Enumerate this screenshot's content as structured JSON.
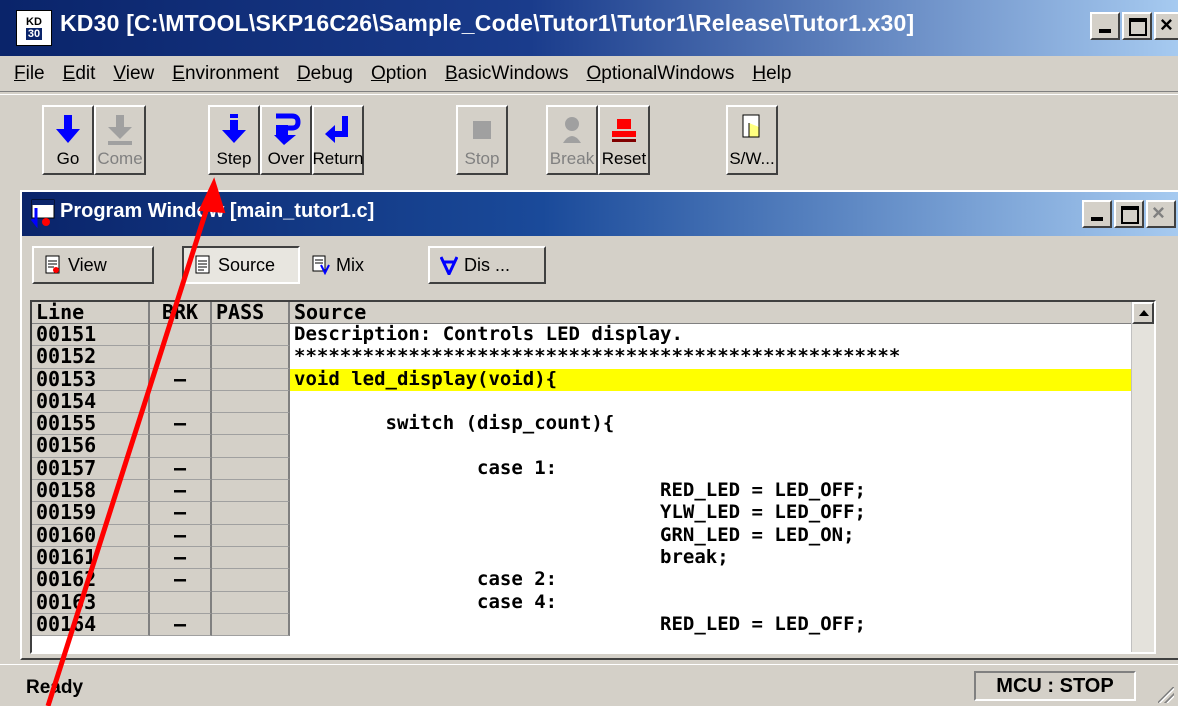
{
  "window": {
    "title": "KD30 [C:\\MTOOL\\SKP16C26\\Sample_Code\\Tutor1\\Tutor1\\Release\\Tutor1.x30]",
    "icon_top": "KD",
    "icon_bottom": "30"
  },
  "menu": [
    "File",
    "Edit",
    "View",
    "Environment",
    "Debug",
    "Option",
    "BasicWindows",
    "OptionalWindows",
    "Help"
  ],
  "toolbar": [
    {
      "label": "Go",
      "icon": "arrow-down-icon",
      "enabled": true
    },
    {
      "label": "Come",
      "icon": "come-icon",
      "enabled": false
    },
    {
      "label": "Step",
      "icon": "step-icon",
      "enabled": true
    },
    {
      "label": "Over",
      "icon": "step-over-icon",
      "enabled": true
    },
    {
      "label": "Return",
      "icon": "return-icon",
      "enabled": true
    },
    {
      "label": "Stop",
      "icon": "stop-icon",
      "enabled": false
    },
    {
      "label": "Break",
      "icon": "break-icon",
      "enabled": false
    },
    {
      "label": "Reset",
      "icon": "reset-icon",
      "enabled": true
    },
    {
      "label": "S/W...",
      "icon": "hand-icon",
      "enabled": true
    }
  ],
  "program_window": {
    "title": "Program Window [main_tutor1.c]",
    "view_buttons": [
      "View",
      "Source",
      "Mix",
      "Dis ..."
    ],
    "columns": [
      "Line",
      "BRK",
      "PASS",
      "Source"
    ],
    "rows": [
      {
        "line": "00151",
        "brk": "",
        "src": "Description: Controls LED display."
      },
      {
        "line": "00152",
        "brk": "",
        "src": "*****************************************************"
      },
      {
        "line": "00153",
        "brk": "–",
        "src": "void led_display(void){",
        "highlight": true
      },
      {
        "line": "00154",
        "brk": "",
        "src": ""
      },
      {
        "line": "00155",
        "brk": "–",
        "src": "        switch (disp_count){"
      },
      {
        "line": "00156",
        "brk": "",
        "src": ""
      },
      {
        "line": "00157",
        "brk": "–",
        "src": "                case 1:"
      },
      {
        "line": "00158",
        "brk": "–",
        "src": "                                RED_LED = LED_OFF;"
      },
      {
        "line": "00159",
        "brk": "–",
        "src": "                                YLW_LED = LED_OFF;"
      },
      {
        "line": "00160",
        "brk": "–",
        "src": "                                GRN_LED = LED_ON;"
      },
      {
        "line": "00161",
        "brk": "–",
        "src": "                                break;"
      },
      {
        "line": "00162",
        "brk": "–",
        "src": "                case 2:"
      },
      {
        "line": "00163",
        "brk": "",
        "src": "                case 4:"
      },
      {
        "line": "00164",
        "brk": "–",
        "src": "                                RED_LED = LED_OFF;"
      }
    ]
  },
  "status": {
    "text": "Ready",
    "mcu": "MCU : STOP"
  },
  "colors": {
    "titlebar": "#0a246a",
    "highlight": "#ffff00",
    "arrow": "#ff0000",
    "icon_blue": "#0000ff"
  }
}
